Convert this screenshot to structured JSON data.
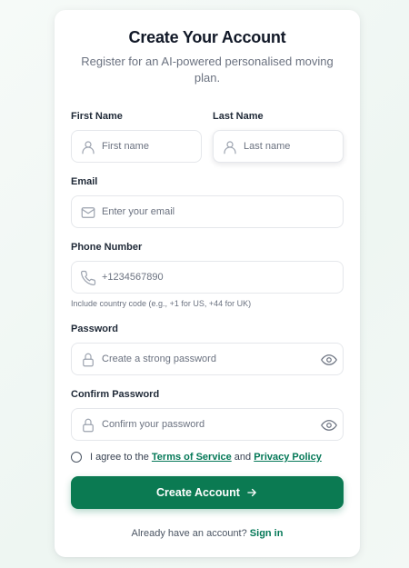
{
  "header": {
    "title": "Create Your Account",
    "subtitle": "Register for an AI-powered personalised moving plan."
  },
  "form": {
    "first_name": {
      "label": "First Name",
      "placeholder": "First name",
      "icon": "user-icon"
    },
    "last_name": {
      "label": "Last Name",
      "placeholder": "Last name",
      "icon": "user-icon"
    },
    "email": {
      "label": "Email",
      "placeholder": "Enter your email",
      "icon": "mail-icon"
    },
    "phone": {
      "label": "Phone Number",
      "placeholder": "+1234567890",
      "icon": "phone-icon",
      "hint": "Include country code (e.g., +1 for US, +44 for UK)"
    },
    "password": {
      "label": "Password",
      "placeholder": "Create a strong password",
      "icon": "lock-icon",
      "toggle_icon": "eye-icon"
    },
    "confirm_password": {
      "label": "Confirm Password",
      "placeholder": "Confirm your password",
      "icon": "lock-icon",
      "toggle_icon": "eye-icon"
    },
    "terms": {
      "prefix": "I agree to the",
      "terms_link": "Terms of Service",
      "middle": "and",
      "privacy_link": "Privacy Policy",
      "checked": false
    },
    "submit_label": "Create Account",
    "submit_icon": "arrow-right-icon"
  },
  "footer": {
    "prompt": "Already have an account?",
    "signin_link": "Sign in"
  },
  "colors": {
    "primary": "#0b7a52",
    "link": "#047857",
    "text": "#1f2937",
    "muted": "#6b7280",
    "border": "#e5e7eb"
  }
}
